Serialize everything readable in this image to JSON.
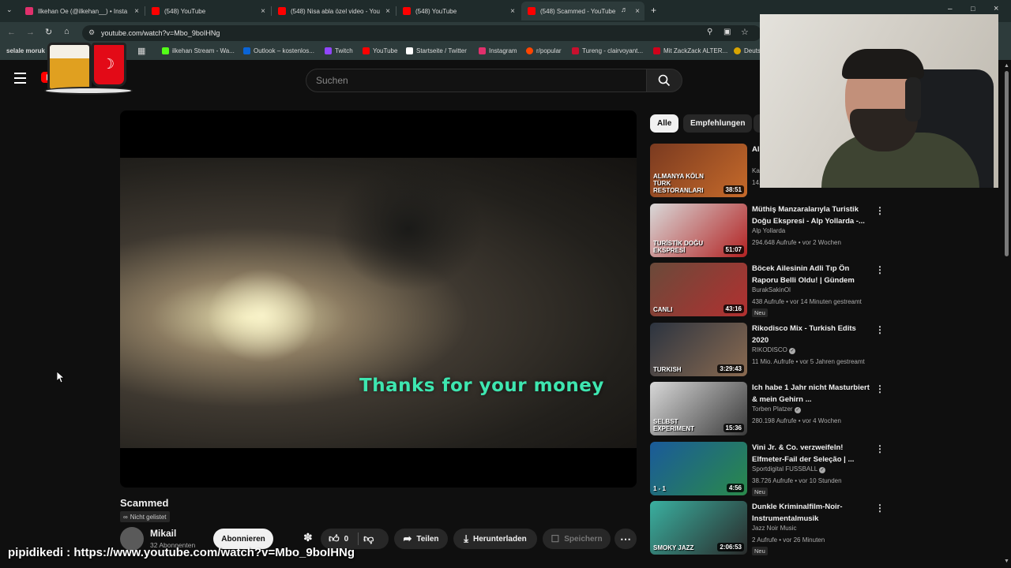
{
  "browser": {
    "tabs": [
      {
        "label": "Ilkehan Oe (@ilkehan__) • Insta",
        "icon_color": "#e1306c"
      },
      {
        "label": "(548) YouTube",
        "icon_color": "#ff0000"
      },
      {
        "label": "(548) Nisa abla özel video - You",
        "icon_color": "#ff0000"
      },
      {
        "label": "(548) YouTube",
        "icon_color": "#ff0000"
      },
      {
        "label": "(548) Scammed - YouTube",
        "icon_color": "#ff0000"
      }
    ],
    "new_tab_symbol": "+",
    "url": "youtube.com/watch?v=Mbo_9boIHNg",
    "bookmarks": [
      {
        "label": "selale moruk",
        "icon_color": ""
      },
      {
        "label": "ilkehan Stream - Wa...",
        "icon_color": "#53fc18"
      },
      {
        "label": "Outlook – kostenlos...",
        "icon_color": "#0a64d6"
      },
      {
        "label": "Twitch",
        "icon_color": "#9146ff"
      },
      {
        "label": "YouTube",
        "icon_color": "#ff0000"
      },
      {
        "label": "Startseite / Twitter",
        "icon_color": "#ffffff"
      },
      {
        "label": "Instagram",
        "icon_color": "#e1306c"
      },
      {
        "label": "r/popular",
        "icon_color": "#ff4500"
      },
      {
        "label": "Tureng - clairvoyant...",
        "icon_color": "#c8102e"
      },
      {
        "label": "Mit ZackZack ALTER...",
        "icon_color": "#d0021b"
      },
      {
        "label": "Deuts",
        "icon_color": "#d9a400"
      }
    ]
  },
  "youtube": {
    "search_placeholder": "Suchen",
    "video": {
      "caption": "Thanks for your money",
      "title": "Scammed",
      "visibility": "Nicht gelistet",
      "channel": "Mikail",
      "subscribers": "32 Abonnenten",
      "subscribe_label": "Abonnieren",
      "like_count": "0",
      "share_label": "Teilen",
      "download_label": "Herunterladen",
      "save_label": "Speichern"
    },
    "chips": [
      "Alle",
      "Empfehlungen"
    ],
    "recommendations": [
      {
        "title": "Al... RE...",
        "channel": "Ka...",
        "meta": "14...",
        "duration": "38:51",
        "thumb_text": "ALMANYA KÖLN TÜRK RESTORANLARI",
        "colors": [
          "#7a3a20",
          "#c66a2a"
        ],
        "verified": false,
        "new": false
      },
      {
        "title": "Müthiş Manzaralarıyla Turistik Doğu Ekspresi - Alp Yollarda -...",
        "channel": "Alp Yollarda",
        "meta": "294.648 Aufrufe • vor 2 Wochen",
        "duration": "51:07",
        "thumb_text": "TURİSTİK DOĞU EKSPRESİ",
        "colors": [
          "#d9d9d9",
          "#b22222"
        ],
        "verified": false,
        "new": false
      },
      {
        "title": "Böcek Ailesinin Adli Tıp Ön Raporu Belli Oldu! | Gündem",
        "channel": "BurakSakinOl",
        "meta": "438 Aufrufe • vor 14 Minuten gestreamt",
        "duration": "43:16",
        "thumb_text": "CANLI",
        "colors": [
          "#6a4a3a",
          "#b23030"
        ],
        "verified": false,
        "new": true
      },
      {
        "title": "Rikodisco Mix - Turkish Edits 2020",
        "channel": "RIKODISCO",
        "meta": "11 Mio. Aufrufe • vor 5 Jahren gestreamt",
        "duration": "3:29:43",
        "thumb_text": "TURKISH",
        "colors": [
          "#2c3440",
          "#8a6a50"
        ],
        "verified": true,
        "new": false
      },
      {
        "title": "Ich habe 1 Jahr nicht Masturbiert & mein Gehirn ...",
        "channel": "Torben Platzer",
        "meta": "280.198 Aufrufe • vor 4 Wochen",
        "duration": "15:36",
        "thumb_text": "SELBST EXPERIMENT",
        "colors": [
          "#d8d8d8",
          "#3a3a3a"
        ],
        "verified": true,
        "new": false
      },
      {
        "title": "Vini Jr. & Co. verzweifeln! Elfmeter-Fail der Seleção | ...",
        "channel": "Sportdigital FUSSBALL",
        "meta": "38.726 Aufrufe • vor 10 Stunden",
        "duration": "4:56",
        "thumb_text": "1 - 1",
        "colors": [
          "#1a5a9a",
          "#2a8a4a"
        ],
        "verified": true,
        "new": true
      },
      {
        "title": "Dunkle Kriminalfilm-Noir-Instrumentalmusik",
        "channel": "Jazz Noir Music",
        "meta": "2 Aufrufe • vor 26 Minuten",
        "duration": "2:06:53",
        "thumb_text": "SMOKY JAZZ",
        "colors": [
          "#3ab0a0",
          "#2a2a2a"
        ],
        "verified": false,
        "new": true
      }
    ],
    "badge_new": "Neu"
  },
  "overlay": {
    "text": "pipidikedi : https://www.youtube.com/watch?v=Mbo_9boIHNg"
  }
}
